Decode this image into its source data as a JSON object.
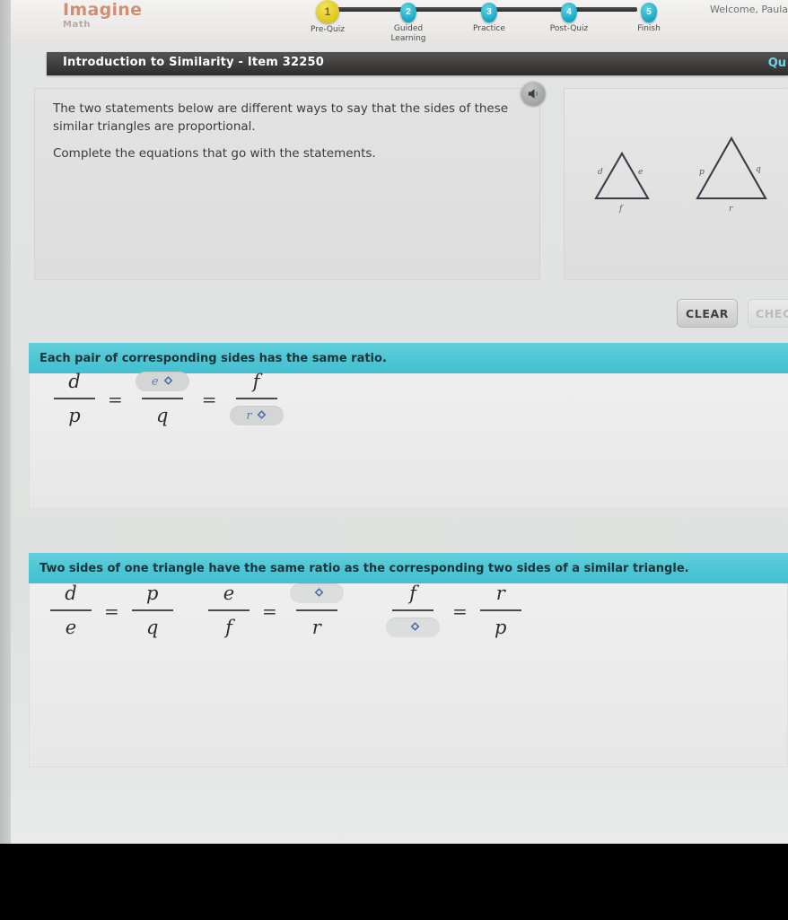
{
  "header": {
    "logo_main": "Imagine",
    "logo_sub": "Math",
    "welcome": "Welcome, Paula",
    "steps": [
      {
        "num": "1",
        "label": "Pre-Quiz",
        "active": true
      },
      {
        "num": "2",
        "label": "Guided Learning",
        "active": false
      },
      {
        "num": "3",
        "label": "Practice",
        "active": false
      },
      {
        "num": "4",
        "label": "Post-Quiz",
        "active": false
      },
      {
        "num": "5",
        "label": "Finish",
        "active": false
      }
    ]
  },
  "titlebar": {
    "title": "Introduction to Similarity - Item 32250",
    "quit_label": "Qu"
  },
  "question": {
    "line1": "The two statements below are different ways to say that the sides of these similar triangles are proportional.",
    "line2": "Complete the equations that go with the statements.",
    "audio_icon": "speaker-icon"
  },
  "figure": {
    "triangle_small": {
      "side_left": "d",
      "side_right": "e",
      "side_bottom": "f"
    },
    "triangle_large": {
      "side_left": "p",
      "side_right": "q",
      "side_bottom": "r"
    }
  },
  "actions": {
    "clear_label": "CLEAR",
    "check_label": "CHECK"
  },
  "card1": {
    "heading": "Each pair of corresponding sides has the same ratio.",
    "equation": {
      "f1": {
        "num": "d",
        "den": "p"
      },
      "eq1": "=",
      "f2": {
        "num_dropdown": "e",
        "den": "q"
      },
      "eq2": "=",
      "f3": {
        "num": "f",
        "den_dropdown": "r"
      }
    }
  },
  "card2": {
    "heading": "Two sides of one triangle have the same ratio as the corresponding two sides of a similar triangle.",
    "equations": [
      {
        "f1": {
          "num": "d",
          "den": "e"
        },
        "eq": "=",
        "f2": {
          "num": "p",
          "den": "q"
        }
      },
      {
        "f1": {
          "num": "e",
          "den": "f"
        },
        "eq": "=",
        "f2": {
          "num_dropdown": "",
          "den": "r"
        }
      },
      {
        "f1": {
          "num": "f",
          "den_dropdown": ""
        },
        "eq": "=",
        "f2": {
          "num": "r",
          "den": "p"
        }
      }
    ]
  },
  "colors": {
    "accent_teal": "#4cc5d4",
    "logo_orange": "#d08f74",
    "dropdown_blue": "#5f7fae",
    "step_active": "#ddc81b",
    "step_done": "#18a8c4"
  }
}
